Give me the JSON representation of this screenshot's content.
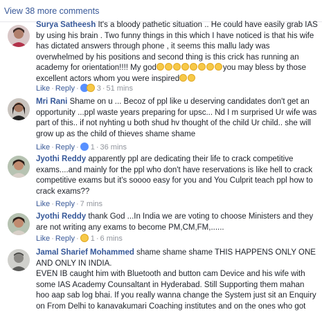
{
  "header": {
    "view_more": "View 38 more comments"
  },
  "actions": {
    "like": "Like",
    "reply": "Reply"
  },
  "comments": [
    {
      "author": "Surya Satheesh",
      "text": " It's a bloody pathetic situation .. He could have easily grab IAS by using his brain . Two funny things in this which I have noticed is that his wife has dictated answers through phone , it seems this mallu lady was overwhelmed by his positions and second thing is this crick has running an academy for orientation!!!! My god",
      "text_after": "you may bless by those excellent actors whom you were inspired",
      "reaction_count": "3",
      "time": "51 mins"
    },
    {
      "author": "Mri Rani",
      "text": " Shame on u ... Becoz of ppl like u deserving candidates don't get an opportunity ...ppl waste years preparing for upsc... Nd I m surprised Ur wife was part of this.. if not nyhting u both shud hv thought of the child Ur child.. she will grow up as the child of thieves shame shame",
      "reaction_count": "1",
      "time": "36 mins"
    },
    {
      "author": "Jyothi Reddy",
      "text": " apparently ppl are dedicating their life to crack competitive exams....and mainly for the ppl who don't have reservations is like hell to crack competitive exams but it's soooo easy for you and You Culprit teach ppl how to crack exams??",
      "time": "7 mins"
    },
    {
      "author": "Jyothi Reddy",
      "text": " thank God ...In India we are voting to choose Ministers and they are not writing any exams to become PM,CM,FM,......",
      "reaction_count": "1",
      "time": "6 mins"
    },
    {
      "author": "Jamal Sharief Mohammed",
      "text": " shame shame shame THIS HAPPENS ONLY ONE AND ONLY IN INDIA.",
      "text2": "EVEN IB caught him with Bluetooth and button cam Device and his wife with some IAS Academy Counsaltant in Hyderabad. Still Supporting them mahan hoo aap sab log bhai. If you really wanna change the System just sit an Enquiry on From Delhi to kanavakumari Coaching institutes and on the ones who got"
    }
  ],
  "colors": {
    "link": "#385898",
    "author": "#365899",
    "meta": "#90949c",
    "divider": "#e5e6ea",
    "text": "#1d2129"
  }
}
